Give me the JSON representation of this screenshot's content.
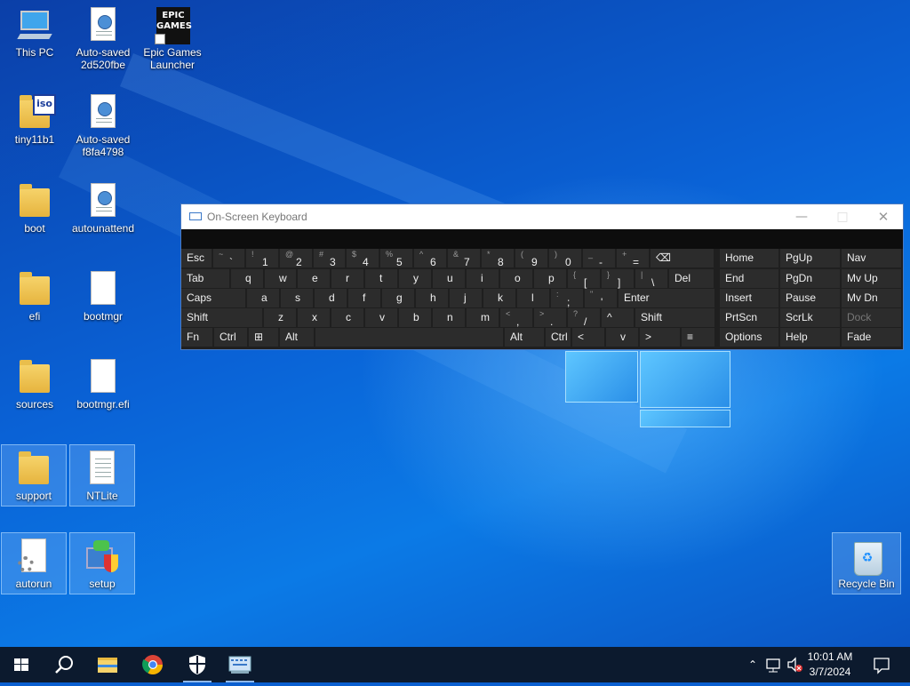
{
  "desktop": {
    "icons": [
      {
        "label": "This PC"
      },
      {
        "label": "Auto-saved 2d520fbe"
      },
      {
        "label": "Epic Games Launcher"
      },
      {
        "label": "tiny11b1"
      },
      {
        "label": "Auto-saved f8fa4798"
      },
      {
        "label": "boot"
      },
      {
        "label": "autounattend"
      },
      {
        "label": "efi"
      },
      {
        "label": "bootmgr"
      },
      {
        "label": "sources"
      },
      {
        "label": "bootmgr.efi"
      },
      {
        "label": "support"
      },
      {
        "label": "NTLite"
      },
      {
        "label": "autorun"
      },
      {
        "label": "setup"
      },
      {
        "label": "Recycle Bin"
      }
    ],
    "epic_logo_text": "EPIC GAMES",
    "iso_badge": "iso"
  },
  "osk": {
    "title": "On-Screen Keyboard",
    "window_buttons": {
      "minimize": "—",
      "maximize": "□",
      "close": "✕"
    },
    "row1": [
      "Esc",
      "~ `",
      "! 1",
      "@ 2",
      "# 3",
      "$ 4",
      "% 5",
      "^ 6",
      "& 7",
      "* 8",
      "( 9",
      ") 0",
      "_ -",
      "+ =",
      "⌫"
    ],
    "row2": [
      "Tab",
      "q",
      "w",
      "e",
      "r",
      "t",
      "y",
      "u",
      "i",
      "o",
      "p",
      "{ [",
      "} ]",
      "| \\",
      "Del"
    ],
    "row3": [
      "Caps",
      "a",
      "s",
      "d",
      "f",
      "g",
      "h",
      "j",
      "k",
      "l",
      ": ;",
      "\" '",
      "Enter"
    ],
    "row4": [
      "Shift",
      "z",
      "x",
      "c",
      "v",
      "b",
      "n",
      "m",
      "< ,",
      "> .",
      "? /",
      "^",
      "Shift"
    ],
    "row5": [
      "Fn",
      "Ctrl",
      "⊞",
      "Alt",
      "",
      "Alt",
      "Ctrl",
      "<",
      "v",
      ">",
      "≡"
    ],
    "nav": [
      [
        "Home",
        "PgUp",
        "Nav"
      ],
      [
        "End",
        "PgDn",
        "Mv Up"
      ],
      [
        "Insert",
        "Pause",
        "Mv Dn"
      ],
      [
        "PrtScn",
        "ScrLk",
        "Dock"
      ],
      [
        "Options",
        "Help",
        "Fade"
      ]
    ]
  },
  "taskbar": {
    "items": [
      "Start",
      "Search",
      "File Explorer",
      "Google Chrome",
      "Security",
      "On-Screen Keyboard"
    ],
    "time": "10:01 AM",
    "date": "3/7/2024"
  },
  "colors": {
    "accent": "#0a62d6",
    "taskbar": "#0c1a2e",
    "osk_key": "#2c2c2c"
  }
}
